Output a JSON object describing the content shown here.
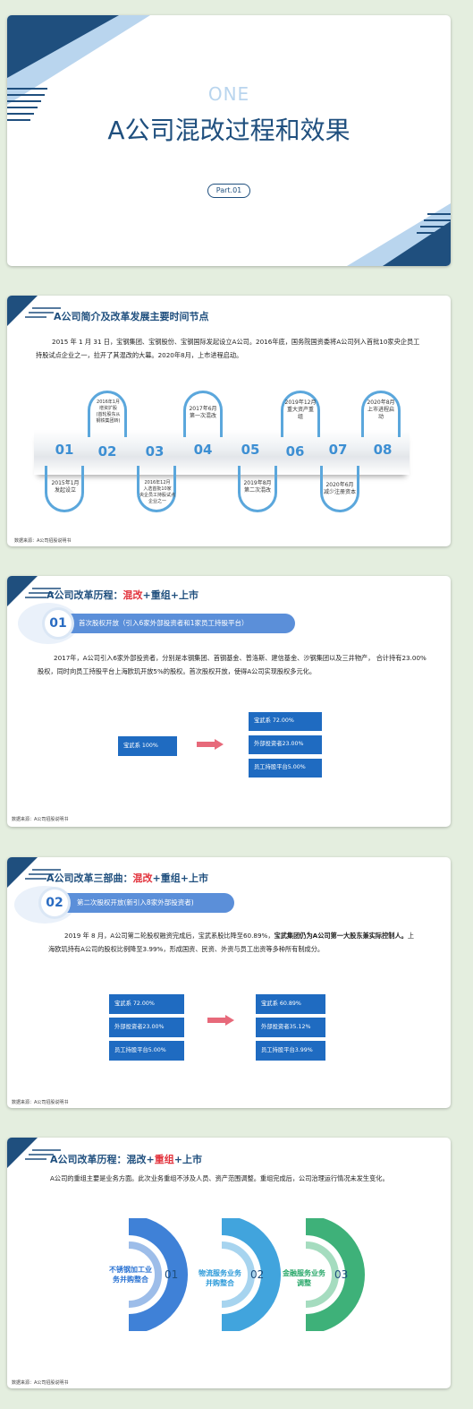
{
  "slide1": {
    "eyebrow": "ONE",
    "title": "A公司混改过程和效果",
    "part": "Part.01"
  },
  "slide2": {
    "title": "A公司简介及改革发展主要时间节点",
    "para": "2015 年 1 月 31 日，宝钢集团、宝钢股份、宝钢国际发起设立A公司。2016年底，国务院国资委将A公司列入首批10家央企员工持股试点企业之一，拉开了其混改的大幕。2020年8月，上市进程启动。",
    "timeline": [
      {
        "num": "01",
        "label": "2015年1月\n发起设立"
      },
      {
        "num": "02",
        "label": "2016年1月\n增资扩股\n(首轮股东从\n钢铁集团转)"
      },
      {
        "num": "03",
        "label": "2016年12月\n入选首批10家\n央企员工持股试点\n企业之一"
      },
      {
        "num": "04",
        "label": "2017年6月\n第一次混改"
      },
      {
        "num": "05",
        "label": "2019年8月\n第二次混改"
      },
      {
        "num": "06",
        "label": "2019年12月\n重大资产重\n组"
      },
      {
        "num": "07",
        "label": "2020年6月\n减少注册资本"
      },
      {
        "num": "08",
        "label": "2020年8月\n上市进程启\n动"
      }
    ],
    "source": "数据来源：A公司招股说明书"
  },
  "slide3": {
    "title_a": "A公司改革历程：",
    "title_b": "混改",
    "title_c": "+重组+上市",
    "step_num": "01",
    "banner": "首次股权开放（引入6家外部投资者和1家员工持股平台）",
    "para": "2017年，A公司引入6家外部投资者，分别是本钢集团、首钢基金、普洛斯、建信基金、沙钢集团以及三井物产， 合计持有23.00%股权，同时向员工持股平台上海欧玑开放5%的股权。首次股权开放，使得A公司实现股权多元化。",
    "before": [
      "宝武系 100%"
    ],
    "after": [
      "宝武系   72.00%",
      "外部投资者23.00%",
      "员工持股平台5.00%"
    ],
    "source": "数据来源：A公司招股说明书"
  },
  "slide4": {
    "title_a": "A公司改革三部曲：",
    "title_b": "混改",
    "title_c": "+重组+上市",
    "step_num": "02",
    "banner": "第二次股权开放(新引入8家外部投资者)",
    "para_a": "2019 年 8 月，A公司第二轮股权融资完成后，宝武系股比降至60.89%，",
    "para_b": "宝武集团仍为A公司第一大股东兼实际控制人。",
    "para_c": "上海欧玑持有A公司的股权比例降至3.99%，形成国资、民资、外资与员工出资等多种所有制成分。",
    "before": [
      "宝武系   72.00%",
      "外部投资者23.00%",
      "员工持股平台5.00%"
    ],
    "after": [
      "宝武系 60.89%",
      "外部投资者35.12%",
      "员工持股平台3.99%"
    ],
    "source": "数据来源：A公司招股说明书"
  },
  "slide5": {
    "title_a": "A公司改革历程：混改+",
    "title_b": "重组",
    "title_c": "+上市",
    "para": "A公司的重组主要是业务方面。此次业务重组不涉及人员、资产范围调整。重组完成后，公司治理运行情况未发生变化。",
    "items": [
      {
        "label": "不锈钢加工业务并购整合",
        "num": "01",
        "color": "#2a73d3"
      },
      {
        "label": "物流服务业务并购整合",
        "num": "02",
        "color": "#2c9ad9"
      },
      {
        "label": "金融服务业务调整",
        "num": "03",
        "color": "#29a86a"
      }
    ],
    "source": "数据来源：A公司招股说明书"
  },
  "colors": {
    "navy": "#1f4f7e",
    "accent_red": "#e2313b",
    "box_blue": "#1f6bc1",
    "light_blue": "#b9d5ee"
  }
}
